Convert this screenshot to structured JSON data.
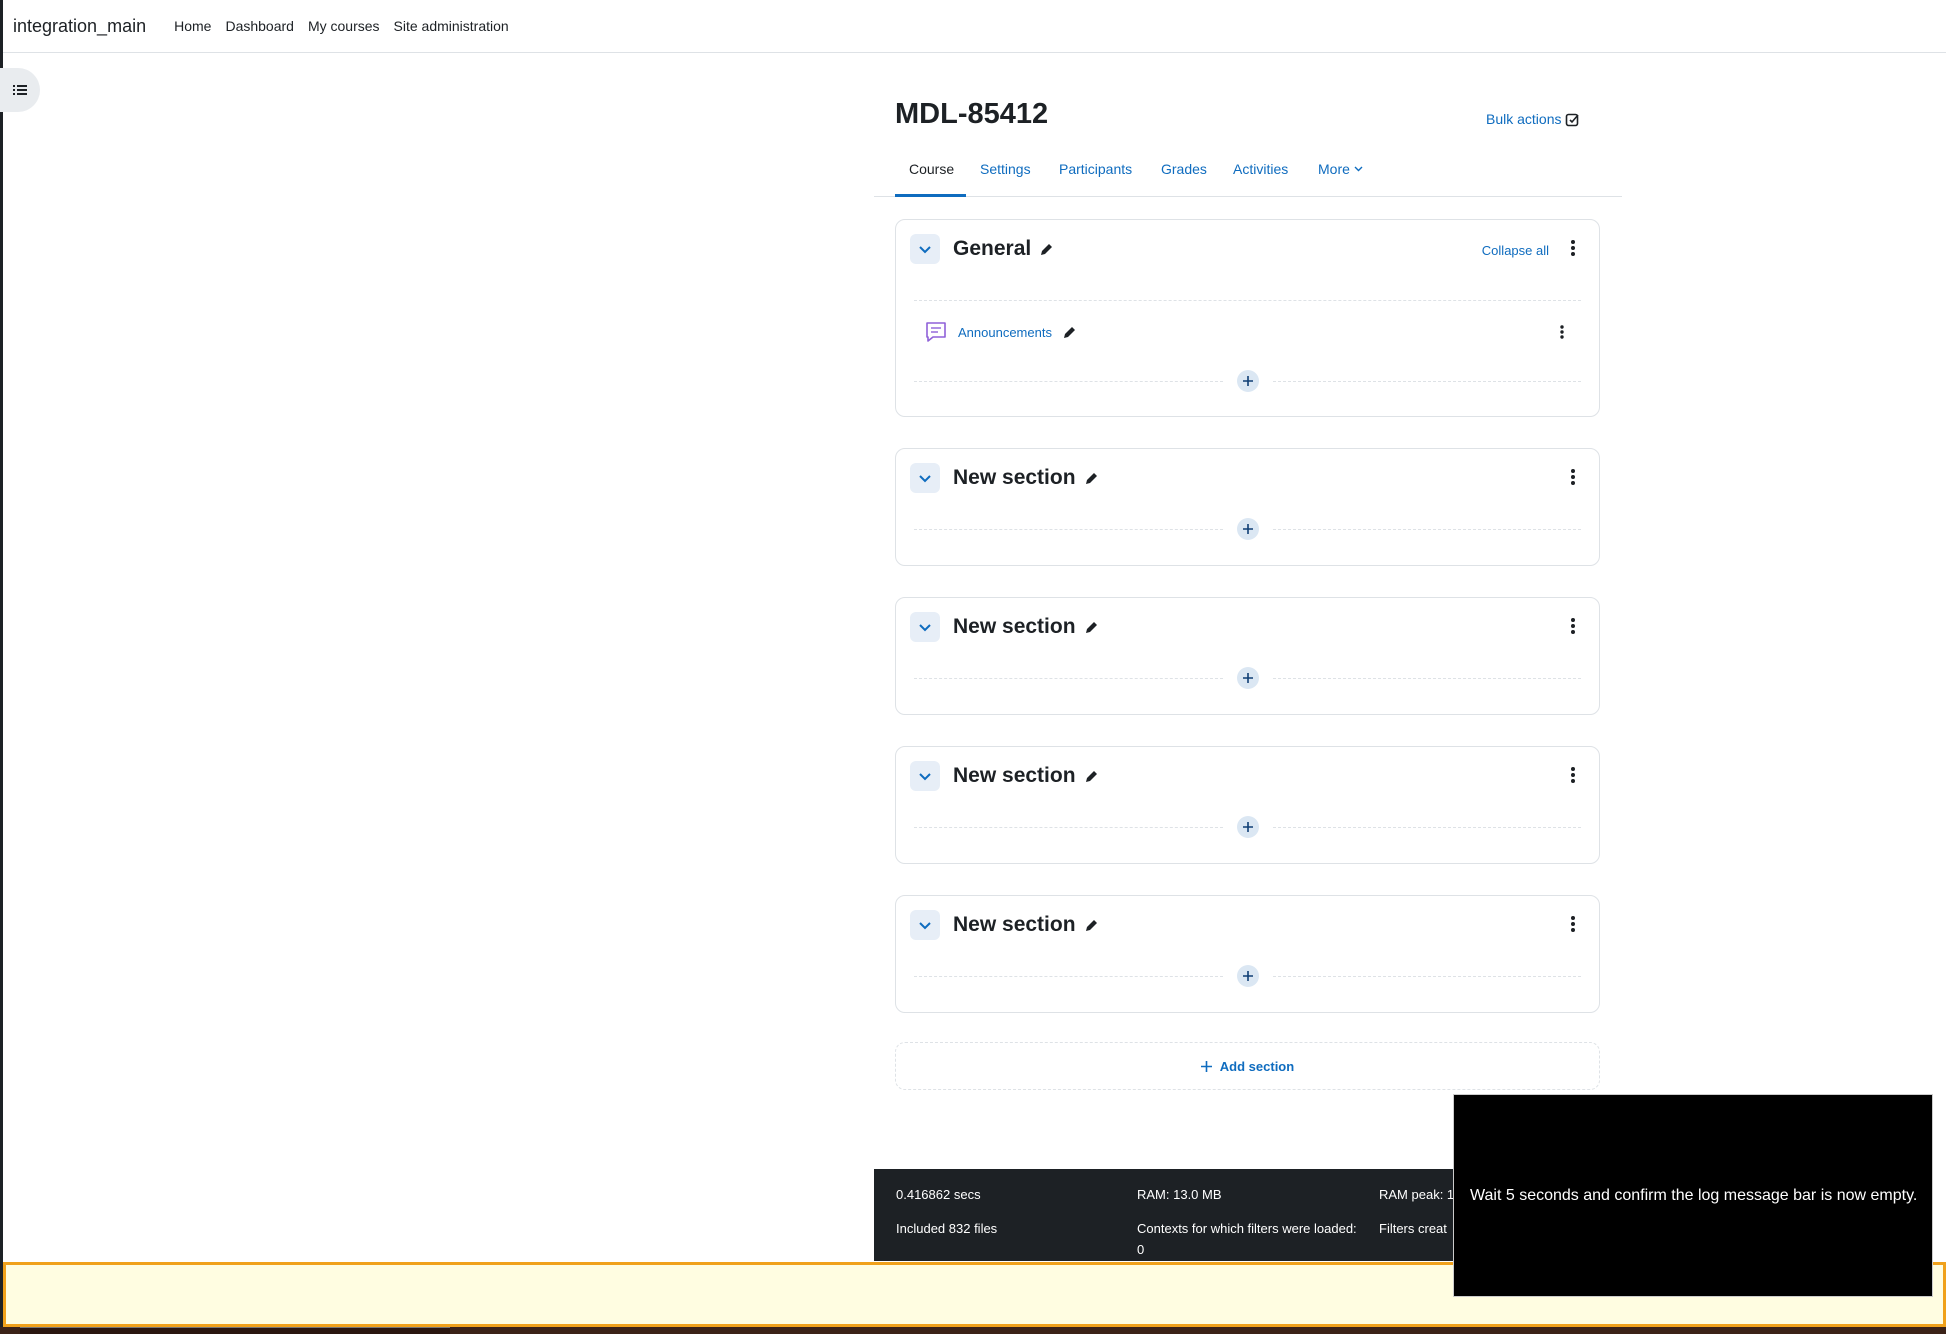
{
  "navbar": {
    "brand": "integration_main",
    "links": [
      "Home",
      "Dashboard",
      "My courses",
      "Site administration"
    ]
  },
  "course": {
    "title": "MDL-85412",
    "bulk_actions": "Bulk actions",
    "tabs": [
      "Course",
      "Settings",
      "Participants",
      "Grades",
      "Activities",
      "More"
    ]
  },
  "sections": [
    {
      "title": "General",
      "collapse_all": "Collapse all",
      "activities": [
        "Announcements"
      ]
    },
    {
      "title": "New section"
    },
    {
      "title": "New section"
    },
    {
      "title": "New section"
    },
    {
      "title": "New section"
    }
  ],
  "add_section": "Add section",
  "footer": {
    "time": "0.416862 secs",
    "ram": "RAM: 13.0 MB",
    "ram_peak": "RAM peak: 1",
    "included_files": "Included 832 files",
    "contexts": "Contexts for which filters were loaded: 0",
    "filters": "Filters creat"
  },
  "overlay": {
    "message": "Wait 5 seconds and confirm the log message bar is now empty."
  },
  "log_bar": {
    "message": ""
  },
  "colors": {
    "link": "#0f6cbf",
    "footer_bg": "#1d2125",
    "log_bar_bg": "#fffde1",
    "log_bar_border": "#f0a11b"
  }
}
